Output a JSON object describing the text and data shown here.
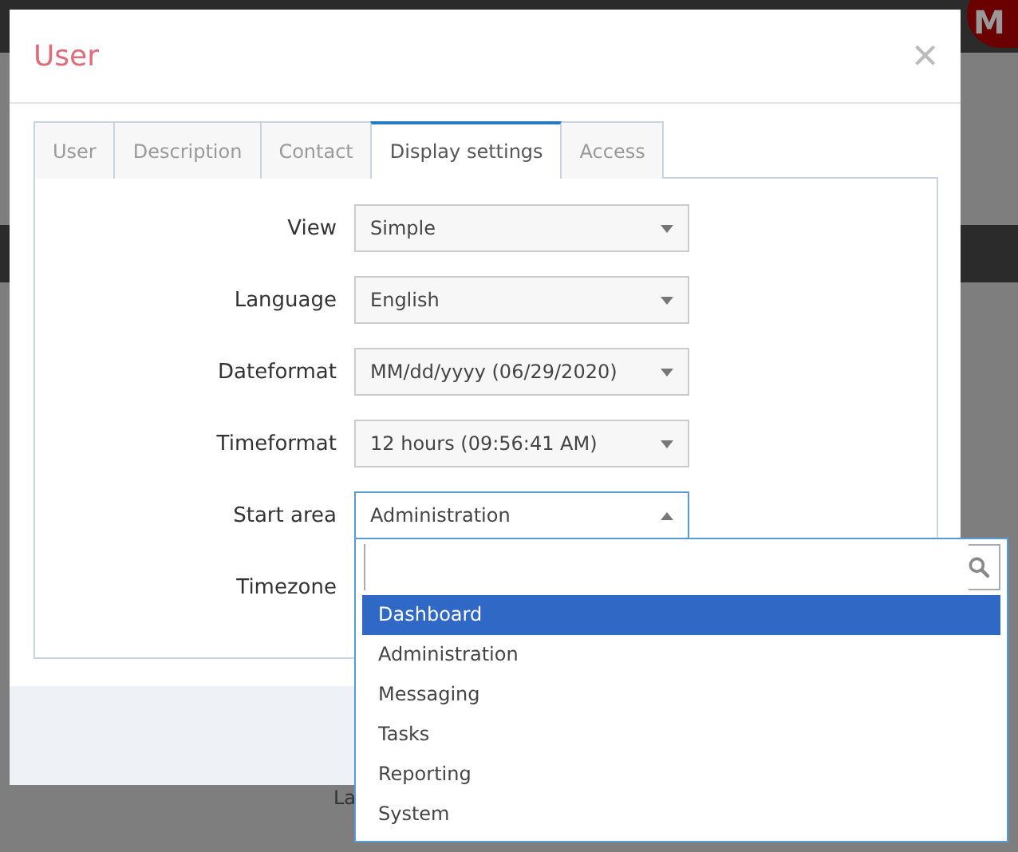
{
  "background": {
    "avatar": "M",
    "label": "La"
  },
  "dialog": {
    "title": "User",
    "close": "×",
    "tabs": [
      {
        "label": "User",
        "selected": false
      },
      {
        "label": "Description",
        "selected": false
      },
      {
        "label": "Contact",
        "selected": false
      },
      {
        "label": "Display settings",
        "selected": true
      },
      {
        "label": "Access",
        "selected": false
      }
    ],
    "fields": [
      {
        "label": "View",
        "value": "Simple"
      },
      {
        "label": "Language",
        "value": "English"
      },
      {
        "label": "Dateformat",
        "value": "MM/dd/yyyy (06/29/2020)"
      },
      {
        "label": "Timeformat",
        "value": "12 hours (09:56:41 AM)"
      },
      {
        "label": "Start area",
        "value": "Administration",
        "dropdown": {
          "options": [
            {
              "label": "Dashboard",
              "selected": true
            },
            {
              "label": "Administration",
              "selected": false
            },
            {
              "label": "Messaging",
              "selected": false
            },
            {
              "label": "Tasks",
              "selected": false
            },
            {
              "label": "Reporting",
              "selected": false
            },
            {
              "label": "System",
              "selected": false
            }
          ]
        }
      },
      {
        "label": "Timezone"
      }
    ]
  }
}
